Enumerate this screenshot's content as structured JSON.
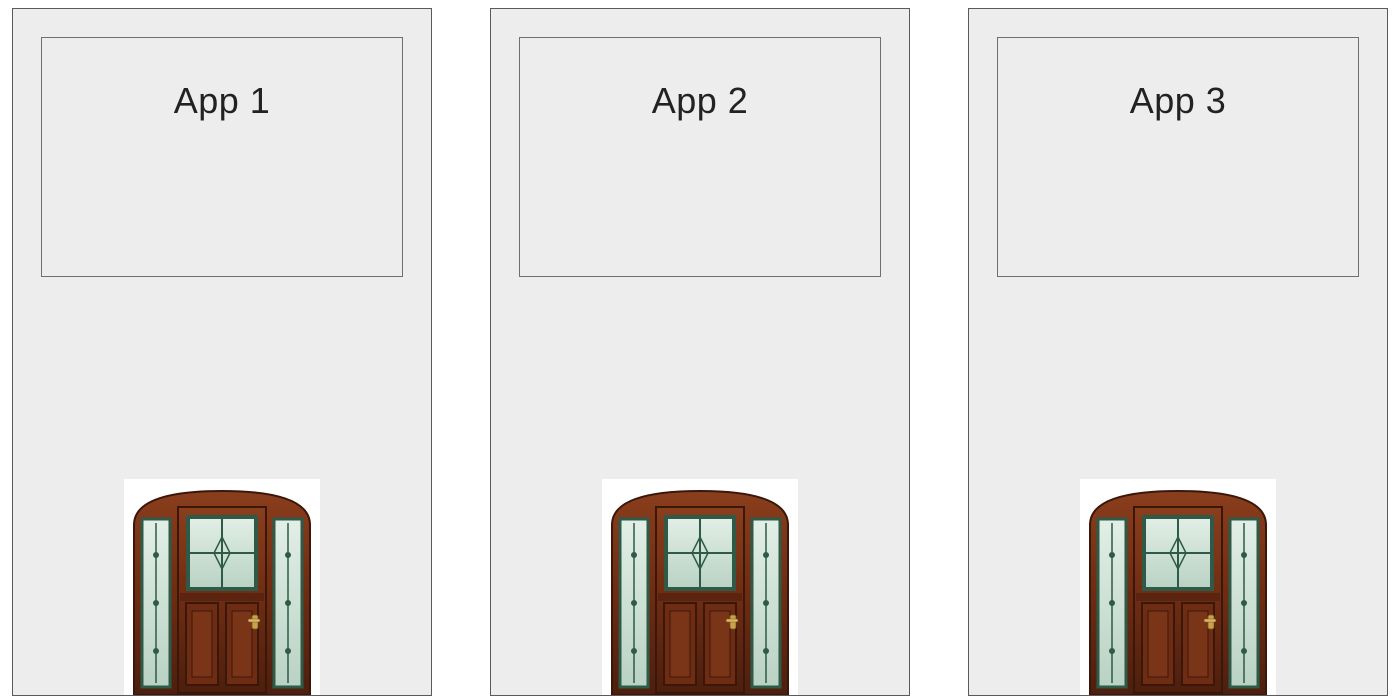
{
  "panels": [
    {
      "label": "App 1",
      "icon": "door-icon"
    },
    {
      "label": "App 2",
      "icon": "door-icon"
    },
    {
      "label": "App 3",
      "icon": "door-icon"
    }
  ],
  "colors": {
    "panel_bg": "#ededed",
    "panel_border": "#5a5a5a",
    "door_wood": "#7a3418",
    "door_wood_dark": "#4d1f0e",
    "door_glass": "#cfe0d6",
    "door_trim": "#2e5a47",
    "door_handle": "#c9a24a"
  }
}
